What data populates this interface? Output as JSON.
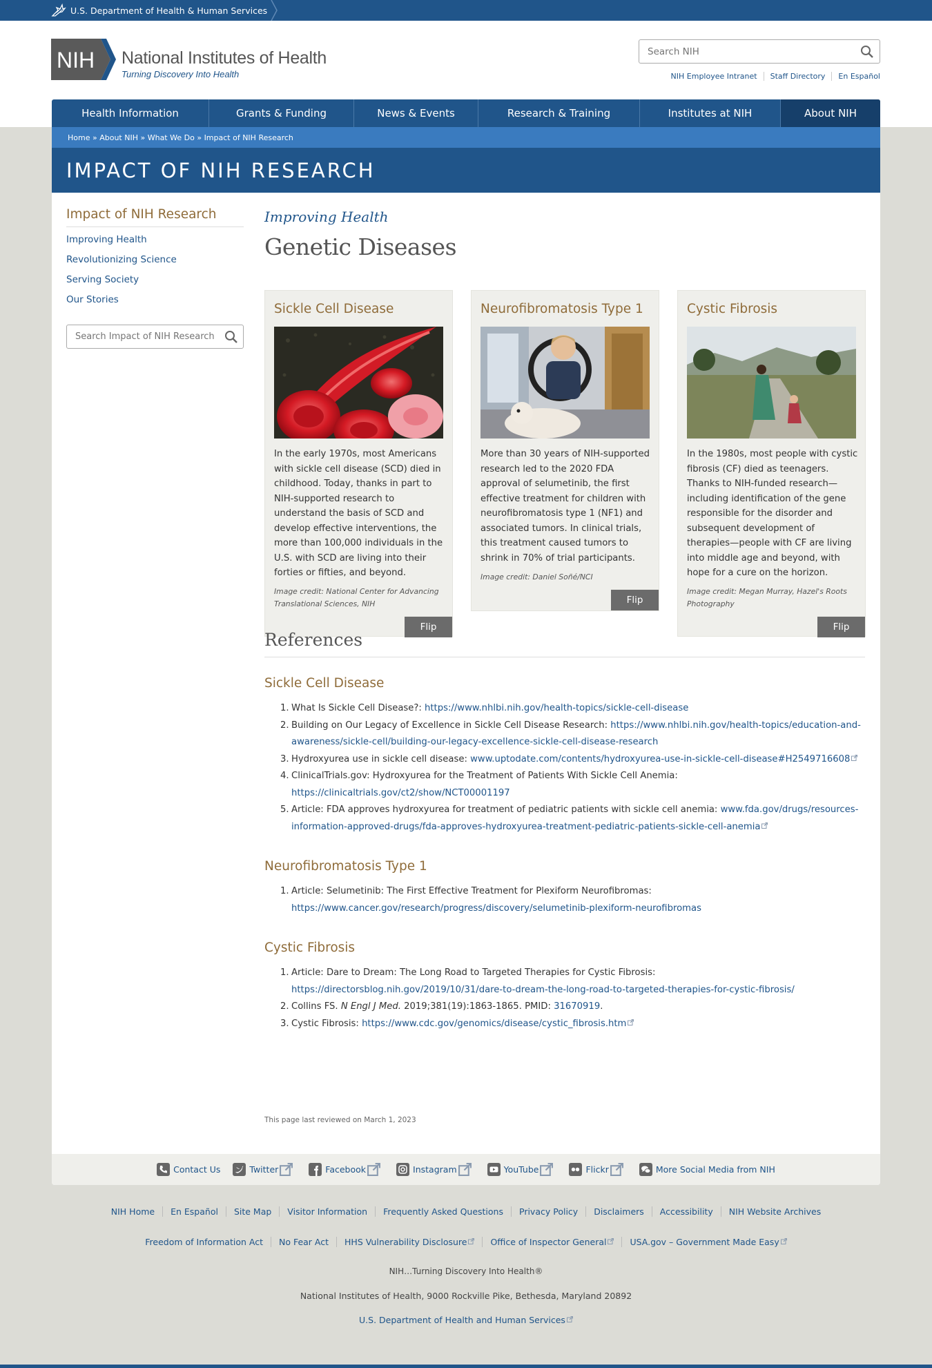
{
  "hhs_bar": {
    "label": "U.S. Department of Health & Human Services"
  },
  "header": {
    "logo_mark": "NIH",
    "logo_title": "National Institutes of Health",
    "logo_tagline": "Turning Discovery Into Health",
    "search_placeholder": "Search NIH",
    "util_links": [
      "NIH Employee Intranet",
      "Staff Directory",
      "En Español"
    ]
  },
  "nav": {
    "items": [
      "Health Information",
      "Grants & Funding",
      "News & Events",
      "Research & Training",
      "Institutes at NIH",
      "About NIH"
    ],
    "active": "About NIH"
  },
  "breadcrumb": [
    "Home",
    "About NIH",
    "What We Do",
    "Impact of NIH Research"
  ],
  "banner_title": "IMPACT OF NIH RESEARCH",
  "sidebar": {
    "title": "Impact of NIH Research",
    "links": [
      "Improving Health",
      "Revolutionizing Science",
      "Serving Society",
      "Our Stories"
    ],
    "search_placeholder": "Search Impact of NIH Research"
  },
  "main": {
    "kicker": "Improving Health",
    "title": "Genetic Diseases"
  },
  "cards": [
    {
      "title": "Sickle Cell Disease",
      "image": "sickle-cell-blood-cells-image",
      "description": "In the early 1970s, most Americans with sickle cell disease (SCD) died in childhood. Today, thanks in part to NIH-supported research to understand the basis of SCD and develop effective interventions, the more than 100,000 individuals in the U.S. with SCD are living into their forties or fifties, and beyond.",
      "credit": "Image credit: National Center for Advancing Translational Sciences, NIH",
      "flip_label": "Flip"
    },
    {
      "title": "Neurofibromatosis Type 1",
      "image": "boy-in-wheelchair-with-dog-image",
      "description": "More than 30 years of NIH-supported research led to the 2020 FDA approval of selumetinib, the first effective treatment for children with neurofibromatosis type 1 (NF1) and associated tumors. In clinical trials, this treatment caused tumors to shrink in 70% of trial participants.",
      "credit": "Image credit: Daniel Soñé/NCI",
      "flip_label": "Flip"
    },
    {
      "title": "Cystic Fibrosis",
      "image": "mother-and-child-walking-image",
      "description": "In the 1980s, most people with cystic fibrosis (CF) died as teenagers. Thanks to NIH-funded research—including identification of the gene responsible for the disorder and subsequent development of therapies—people with CF are living into middle age and beyond, with hope for a cure on the horizon.",
      "credit": "Image credit: Megan Murray, Hazel's Roots Photography",
      "flip_label": "Flip"
    }
  ],
  "references": {
    "title": "References",
    "sections": [
      {
        "heading": "Sickle Cell Disease",
        "items": [
          {
            "text": "What Is Sickle Cell Disease?: ",
            "link": "https://www.nhlbi.nih.gov/health-topics/sickle-cell-disease",
            "external": false
          },
          {
            "text": "Building on Our Legacy of Excellence in Sickle Cell Disease Research: ",
            "link": "https://www.nhlbi.nih.gov/health-topics/education-and-awareness/sickle-cell/building-our-legacy-excellence-sickle-cell-disease-research",
            "external": false
          },
          {
            "text": "Hydroxyurea use in sickle cell disease: ",
            "link": "www.uptodate.com/contents/hydroxyurea-use-in-sickle-cell-disease#H2549716608",
            "external": true
          },
          {
            "text": "ClinicalTrials.gov: Hydroxyurea for the Treatment of Patients With Sickle Cell Anemia: ",
            "link": "https://clinicaltrials.gov/ct2/show/NCT00001197",
            "external": false
          },
          {
            "text": "Article: FDA approves hydroxyurea for treatment of pediatric patients with sickle cell anemia: ",
            "link": "www.fda.gov/drugs/resources-information-approved-drugs/fda-approves-hydroxyurea-treatment-pediatric-patients-sickle-cell-anemia",
            "external": true
          }
        ]
      },
      {
        "heading": "Neurofibromatosis Type 1",
        "items": [
          {
            "text": "Article: Selumetinib: The First Effective Treatment for Plexiform Neurofibromas: ",
            "link": "https://www.cancer.gov/research/progress/discovery/selumetinib-plexiform-neurofibromas",
            "external": false
          }
        ]
      },
      {
        "heading": "Cystic Fibrosis",
        "items": [
          {
            "text": "Article: Dare to Dream: The Long Road to Targeted Therapies for Cystic Fibrosis: ",
            "link": "https://directorsblog.nih.gov/2019/10/31/dare-to-dream-the-long-road-to-targeted-therapies-for-cystic-fibrosis/",
            "external": false
          },
          {
            "text_pre": "Collins FS. ",
            "text_italic": "N Engl J Med.",
            "text_post": " 2019;381(19):1863-1865. PMID: ",
            "link": "31670919",
            "link_suffix": ".",
            "external": false
          },
          {
            "text": "Cystic Fibrosis: ",
            "link": "https://www.cdc.gov/genomics/disease/cystic_fibrosis.htm",
            "external": true
          }
        ]
      }
    ]
  },
  "reviewed": "This page last reviewed on March 1, 2023",
  "social": [
    {
      "label": "Contact Us",
      "icon": "phone-icon",
      "external": false
    },
    {
      "label": "Twitter",
      "icon": "twitter-icon",
      "external": true
    },
    {
      "label": "Facebook",
      "icon": "facebook-icon",
      "external": true
    },
    {
      "label": "Instagram",
      "icon": "instagram-icon",
      "external": true
    },
    {
      "label": "YouTube",
      "icon": "youtube-icon",
      "external": true
    },
    {
      "label": "Flickr",
      "icon": "flickr-icon",
      "external": true
    },
    {
      "label": "More Social Media from NIH",
      "icon": "chat-bubbles-icon",
      "external": false
    }
  ],
  "footer": {
    "row1": [
      "NIH Home",
      "En Español",
      "Site Map",
      "Visitor Information",
      "Frequently Asked Questions",
      "Privacy Policy",
      "Disclaimers",
      "Accessibility",
      "NIH Website Archives"
    ],
    "row2": [
      {
        "label": "Freedom of Information Act",
        "external": false
      },
      {
        "label": "No Fear Act",
        "external": false
      },
      {
        "label": "HHS Vulnerability Disclosure",
        "external": true
      },
      {
        "label": "Office of Inspector General",
        "external": true
      },
      {
        "label": "USA.gov – Government Made Easy",
        "external": true
      }
    ],
    "tagline": "NIH…Turning Discovery Into Health®",
    "address": "National Institutes of Health, 9000 Rockville Pike, Bethesda, Maryland 20892",
    "hhs_link": "U.S. Department of Health and Human Services"
  },
  "colors": {
    "nih_blue": "#20558a",
    "nav_active": "#163f6a",
    "breadcrumb_blue": "#3a7bbf",
    "gold_heading": "#8f6c3a",
    "card_bg": "#efefeb",
    "flip_button": "#6b6b6b",
    "page_bg": "#dcdcd6"
  }
}
